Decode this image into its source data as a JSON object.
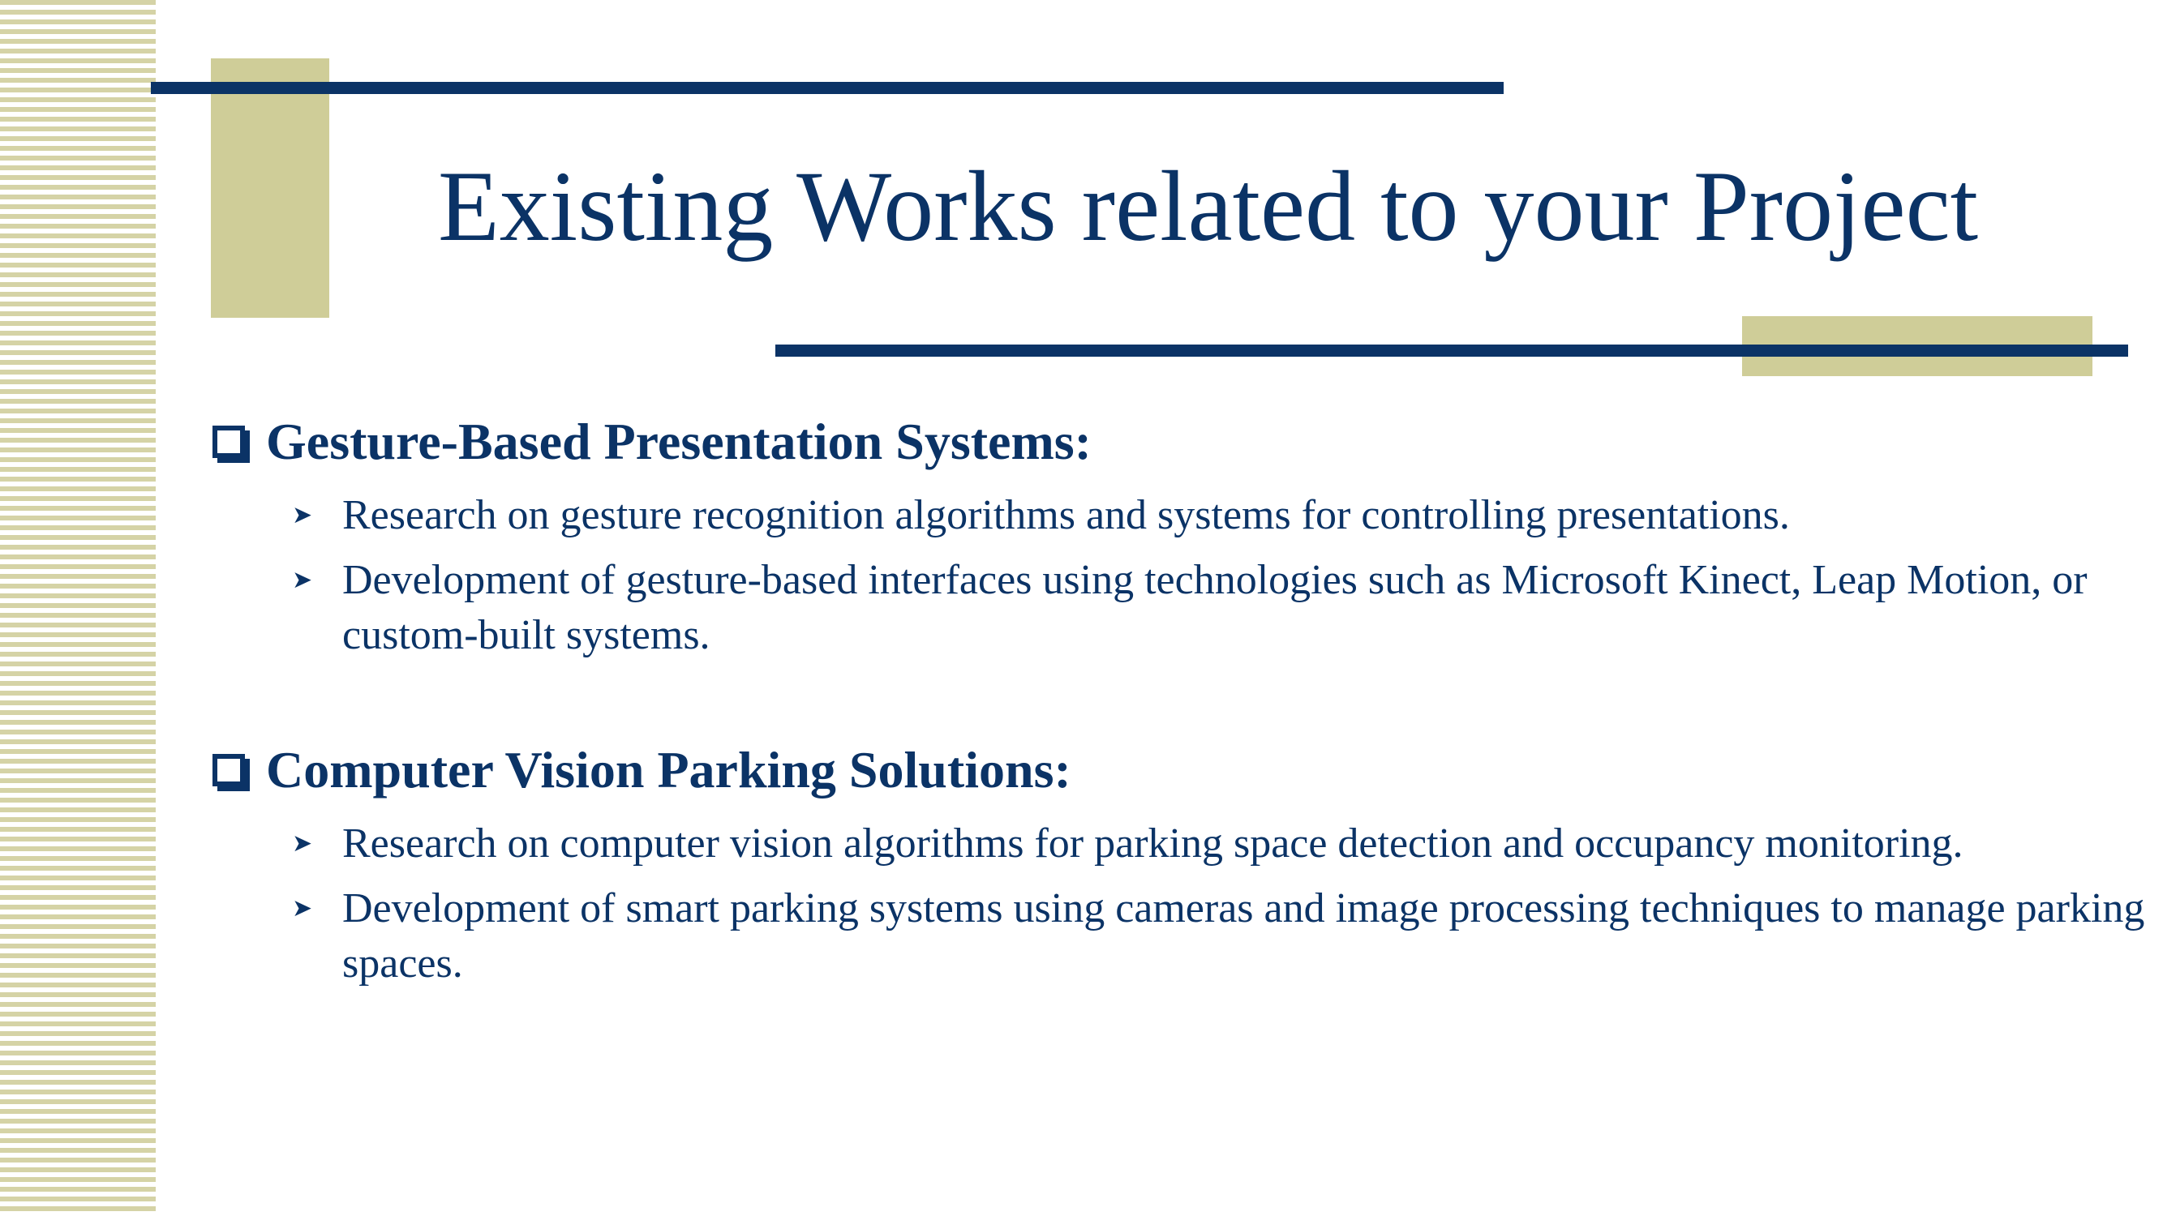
{
  "slide": {
    "title": "Existing Works related to your Project",
    "colors": {
      "accent": "#0b3366",
      "olive": "#cfcd98",
      "stripe": "#d5d3a6"
    },
    "sections": [
      {
        "heading": "Gesture-Based Presentation Systems:",
        "bullet_icon": "checkbox-square-icon",
        "items": [
          "Research on gesture recognition algorithms and systems for controlling presentations.",
          "Development of gesture-based interfaces using technologies such as Microsoft Kinect, Leap Motion, or custom-built systems."
        ]
      },
      {
        "heading": "Computer Vision Parking Solutions:",
        "bullet_icon": "checkbox-square-icon",
        "items": [
          "Research on computer vision algorithms for parking space detection and occupancy monitoring.",
          "Development of smart parking systems using cameras and image processing techniques to manage parking spaces."
        ]
      }
    ],
    "sub_bullet_icon": "arrowhead-icon"
  }
}
